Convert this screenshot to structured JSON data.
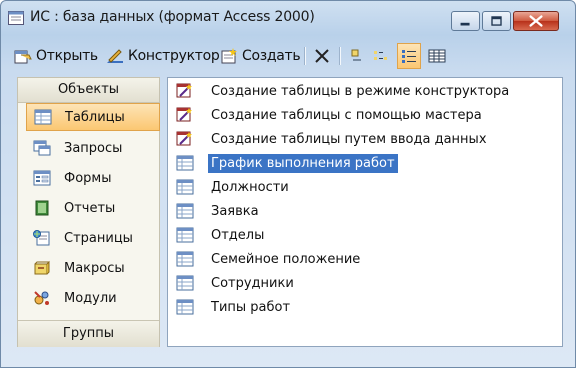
{
  "window": {
    "title": "ИС : база данных (формат Access 2000)"
  },
  "toolbar": {
    "open": "Открыть",
    "design": "Конструктор",
    "create": "Создать"
  },
  "objects_panel": {
    "header": "Объекты",
    "items": [
      {
        "label": "Таблицы"
      },
      {
        "label": "Запросы"
      },
      {
        "label": "Формы"
      },
      {
        "label": "Отчеты"
      },
      {
        "label": "Страницы"
      },
      {
        "label": "Макросы"
      },
      {
        "label": "Модули"
      }
    ],
    "footer": "Группы"
  },
  "list": {
    "items": [
      {
        "label": "Создание таблицы в режиме конструктора",
        "icon": "wizard-icon"
      },
      {
        "label": "Создание таблицы с помощью мастера",
        "icon": "wizard-icon"
      },
      {
        "label": "Создание таблицы путем ввода данных",
        "icon": "wizard-icon"
      },
      {
        "label": "График выполнения работ",
        "icon": "table-icon",
        "selected": true
      },
      {
        "label": "Должности",
        "icon": "table-icon"
      },
      {
        "label": "Заявка",
        "icon": "table-icon"
      },
      {
        "label": "Отделы",
        "icon": "table-icon"
      },
      {
        "label": "Семейное положение",
        "icon": "table-icon"
      },
      {
        "label": "Сотрудники",
        "icon": "table-icon"
      },
      {
        "label": "Типы работ",
        "icon": "table-icon"
      }
    ]
  },
  "colors": {
    "selection": "#3b74c5",
    "accent": "#fbc772"
  }
}
